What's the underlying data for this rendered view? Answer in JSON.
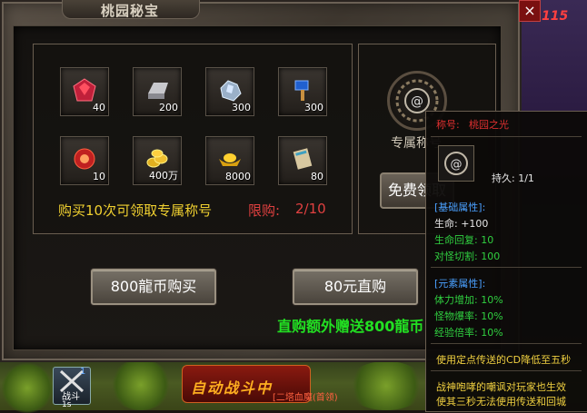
{
  "window": {
    "title": "桃园秘宝",
    "close_glyph": "×",
    "hp_overlay": "115"
  },
  "rewards": [
    {
      "icon": "red-gem-icon",
      "count": "40"
    },
    {
      "icon": "silver-ingot-icon",
      "count": "200"
    },
    {
      "icon": "ore-crystal-icon",
      "count": "300"
    },
    {
      "icon": "blue-hammer-icon",
      "count": "300"
    },
    {
      "icon": "red-pearl-icon",
      "count": "10"
    },
    {
      "icon": "gold-coins-icon",
      "count": "400万"
    },
    {
      "icon": "gold-ingot-icon",
      "count": "8000"
    },
    {
      "icon": "scroll-icon",
      "count": "80"
    }
  ],
  "buy_hint": "购买10次可领取专属称号",
  "limit": {
    "label": "限购:",
    "value": "2/10"
  },
  "title_reward": {
    "label": "专属称号",
    "free_button": "免费领取"
  },
  "buttons": {
    "coin_buy": "800龍币购买",
    "direct_buy": "80元直购"
  },
  "bonus_text": "直购额外赠送800龍币",
  "tooltip": {
    "name_label": "称号:",
    "name_value": "桃园之光",
    "durability": "持久: 1/1",
    "base_title": "[基础属性]:",
    "base": [
      "生命: +100",
      "生命回复: 10",
      "对怪切割: 100"
    ],
    "element_title": "[元素属性]:",
    "element": [
      "体力增加: 10%",
      "怪物爆率: 10%",
      "经验倍率: 10%"
    ],
    "effect1": "使用定点传送的CD降低至五秒",
    "effect2_line1": "战神咆哮的嘲讽对玩家也生效",
    "effect2_line2": "使其三秒无法使用传送和回城"
  },
  "hud": {
    "combat_label": "战斗",
    "combat_key": "1",
    "combat_time": "1s",
    "auto_label": "自动战斗中",
    "auto_sub": "[二塔血魔(首领)"
  },
  "colors": {
    "accent_gold": "#f0d030",
    "limit_red": "#e04040",
    "bonus_green": "#22e022",
    "tip_blue": "#4aa0ff"
  }
}
